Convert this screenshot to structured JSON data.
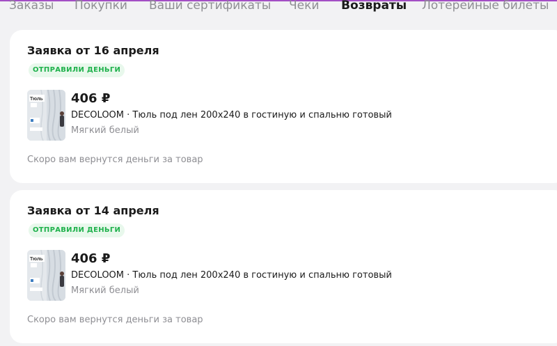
{
  "colors": {
    "accent": "#a34ec4",
    "background": "#f2f2f4",
    "badge_bg": "#e8f8ec",
    "badge_text": "#1eb14b",
    "muted_text": "#8e8e93"
  },
  "tabs": [
    {
      "label": "Заказы",
      "active": false
    },
    {
      "label": "Покупки",
      "active": false
    },
    {
      "label": "Ваши сертификаты",
      "active": false
    },
    {
      "label": "Чеки",
      "active": false
    },
    {
      "label": "Возвраты",
      "active": true
    },
    {
      "label": "Лотерейные билеты",
      "active": false
    }
  ],
  "returns": [
    {
      "title": "Заявка от 16 апреля",
      "status": "ОТПРАВИЛИ ДЕНЬГИ",
      "price": "406 ₽",
      "product_name": "DECOLOOM · Тюль под лен 200x240 в гостиную и спальню готовый",
      "variant": "Мягкий белый",
      "thumbnail_label": "Тюль",
      "note": "Скоро вам вернутся деньги за товар"
    },
    {
      "title": "Заявка от 14 апреля",
      "status": "ОТПРАВИЛИ ДЕНЬГИ",
      "price": "406 ₽",
      "product_name": "DECOLOOM · Тюль под лен 200x240 в гостиную и спальню готовый",
      "variant": "Мягкий белый",
      "thumbnail_label": "Тюль",
      "note": "Скоро вам вернутся деньги за товар"
    }
  ]
}
